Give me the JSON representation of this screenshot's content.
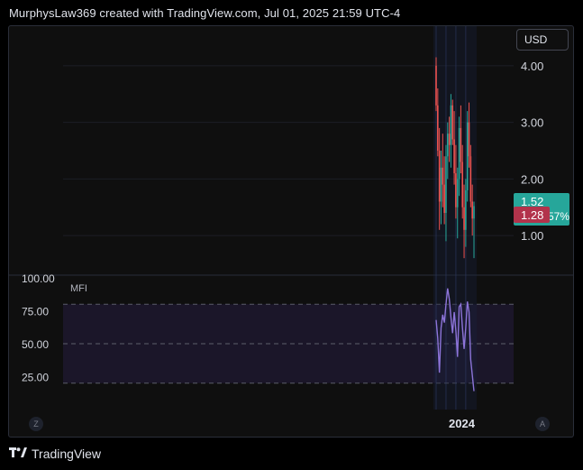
{
  "header": {
    "title": "MurphysLaw369 created with TradingView.com, Jul 01, 2025 21:59 UTC-4"
  },
  "chart": {
    "currency_label": "USD",
    "price_axis_labels": [
      "4.00",
      "3.00",
      "2.00",
      "1.00"
    ],
    "price_tags": {
      "last": {
        "label": "1.52",
        "color": "#26a69a",
        "change": "-57%"
      },
      "secondary": {
        "label": "1.28",
        "color": "#b2334b"
      }
    },
    "indicator": {
      "name": "MFI",
      "axis_labels": [
        "100.00",
        "75.00",
        "50.00",
        "25.00"
      ],
      "band_color": "#2a1f4a",
      "line_color": "#8d74d9"
    },
    "time_axis": {
      "label": "2024"
    },
    "buttons": {
      "left": "Z",
      "right": "A"
    },
    "up_color": "#26a69a",
    "down_color": "#ef5350"
  },
  "footer": {
    "logo_icon": "tradingview-logo-icon",
    "brand": "TradingView"
  },
  "chart_data": {
    "type": "candlestick",
    "y_range": [
      0.3,
      4.7
    ],
    "mfi_range": [
      0,
      100
    ],
    "mfi_levels": [
      80,
      50,
      20
    ],
    "candles": [
      {
        "o": 4.0,
        "h": 4.15,
        "l": 3.2,
        "c": 3.3
      },
      {
        "o": 3.3,
        "h": 3.6,
        "l": 2.4,
        "c": 2.5
      },
      {
        "o": 2.5,
        "h": 2.9,
        "l": 1.1,
        "c": 1.6
      },
      {
        "o": 1.6,
        "h": 2.5,
        "l": 1.2,
        "c": 2.2
      },
      {
        "o": 2.2,
        "h": 2.8,
        "l": 1.5,
        "c": 1.9
      },
      {
        "o": 1.9,
        "h": 2.4,
        "l": 1.2,
        "c": 1.4
      },
      {
        "o": 1.4,
        "h": 2.6,
        "l": 0.9,
        "c": 2.4
      },
      {
        "o": 2.4,
        "h": 3.0,
        "l": 2.0,
        "c": 2.8
      },
      {
        "o": 2.8,
        "h": 3.1,
        "l": 2.3,
        "c": 2.6
      },
      {
        "o": 2.6,
        "h": 3.5,
        "l": 2.2,
        "c": 3.3
      },
      {
        "o": 3.3,
        "h": 3.4,
        "l": 2.6,
        "c": 2.7
      },
      {
        "o": 2.7,
        "h": 3.2,
        "l": 1.9,
        "c": 2.1
      },
      {
        "o": 2.1,
        "h": 2.6,
        "l": 1.3,
        "c": 1.5
      },
      {
        "o": 1.5,
        "h": 2.2,
        "l": 0.95,
        "c": 2.0
      },
      {
        "o": 2.0,
        "h": 3.1,
        "l": 1.7,
        "c": 2.9
      },
      {
        "o": 2.9,
        "h": 3.3,
        "l": 2.1,
        "c": 2.3
      },
      {
        "o": 2.3,
        "h": 2.6,
        "l": 1.3,
        "c": 1.5
      },
      {
        "o": 1.5,
        "h": 1.9,
        "l": 0.6,
        "c": 1.1
      },
      {
        "o": 1.1,
        "h": 2.0,
        "l": 0.8,
        "c": 1.8
      },
      {
        "o": 1.8,
        "h": 3.2,
        "l": 1.6,
        "c": 3.0
      },
      {
        "o": 3.0,
        "h": 3.35,
        "l": 2.2,
        "c": 2.4
      },
      {
        "o": 2.4,
        "h": 2.6,
        "l": 1.5,
        "c": 1.6
      },
      {
        "o": 1.6,
        "h": 1.9,
        "l": 1.0,
        "c": 1.3
      },
      {
        "o": 1.3,
        "h": 1.6,
        "l": 0.6,
        "c": 1.52
      }
    ],
    "mfi": [
      68,
      54,
      28,
      62,
      72,
      66,
      80,
      92,
      84,
      70,
      58,
      74,
      60,
      40,
      78,
      80,
      62,
      46,
      62,
      82,
      74,
      38,
      26,
      14
    ]
  }
}
